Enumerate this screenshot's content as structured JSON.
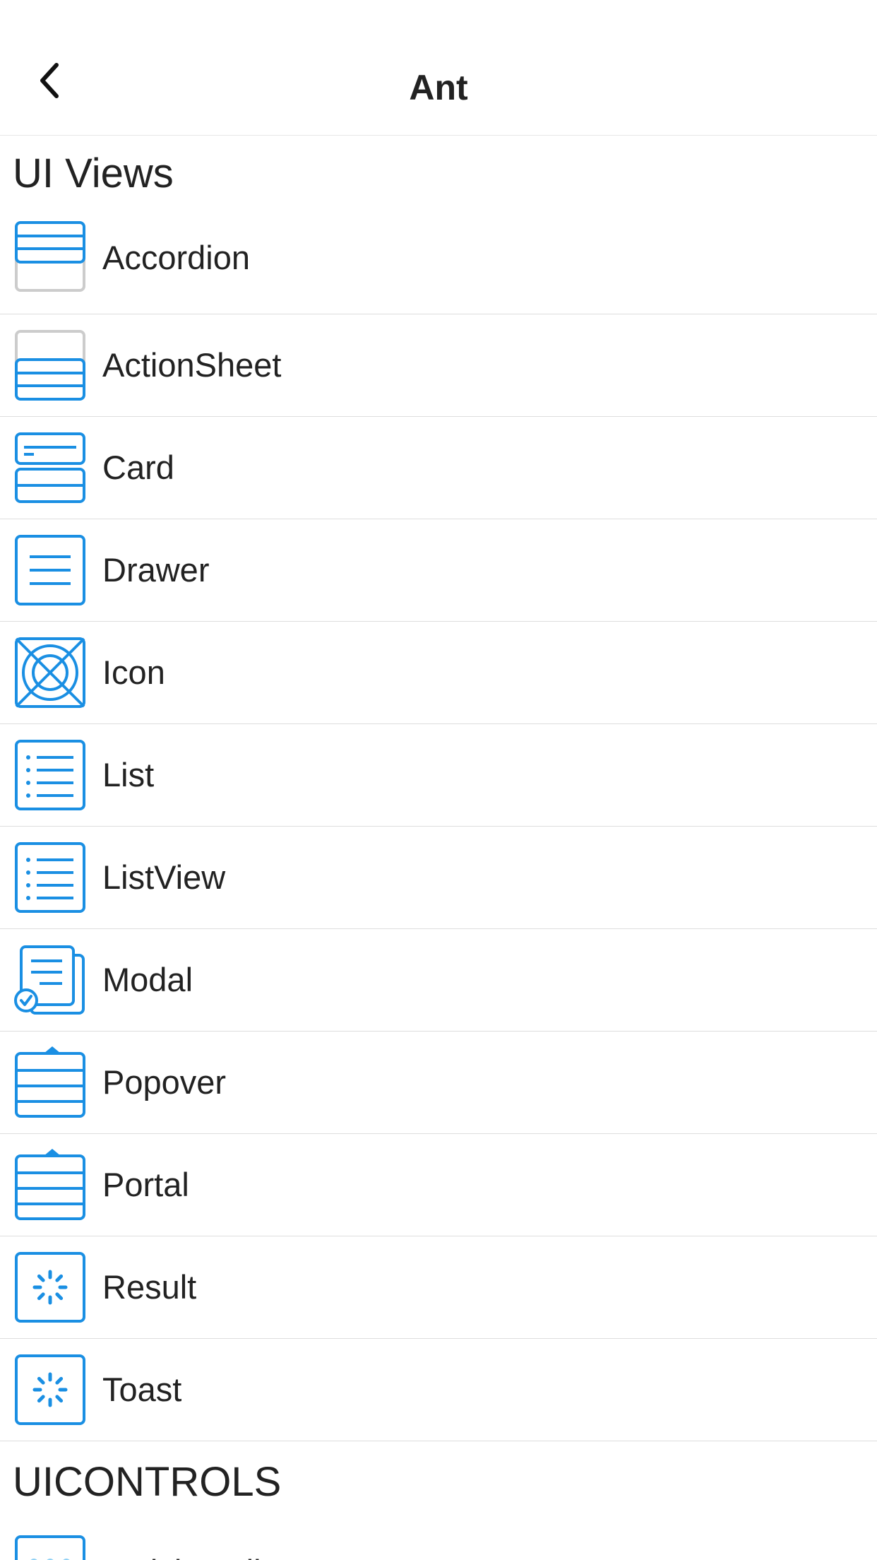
{
  "nav": {
    "title": "Ant",
    "back_icon": "chevron-left-icon"
  },
  "colors": {
    "accent": "#1a8fe3",
    "muted": "#cccccc",
    "divider": "#dddddd",
    "text": "#222222"
  },
  "sections": [
    {
      "title": "UI Views",
      "items": [
        {
          "label": "Accordion",
          "icon": "accordion-icon"
        },
        {
          "label": "ActionSheet",
          "icon": "action-sheet-icon"
        },
        {
          "label": "Card",
          "icon": "card-icon"
        },
        {
          "label": "Drawer",
          "icon": "drawer-icon"
        },
        {
          "label": "Icon",
          "icon": "icon-icon"
        },
        {
          "label": "List",
          "icon": "list-icon"
        },
        {
          "label": "ListView",
          "icon": "list-view-icon"
        },
        {
          "label": "Modal",
          "icon": "modal-icon"
        },
        {
          "label": "Popover",
          "icon": "popover-icon"
        },
        {
          "label": "Portal",
          "icon": "portal-icon"
        },
        {
          "label": "Result",
          "icon": "result-icon"
        },
        {
          "label": "Toast",
          "icon": "toast-icon"
        }
      ]
    },
    {
      "title": "UICONTROLS",
      "items": [
        {
          "label": "ActivityIndicator",
          "icon": "activity-indicator-icon"
        }
      ]
    }
  ]
}
